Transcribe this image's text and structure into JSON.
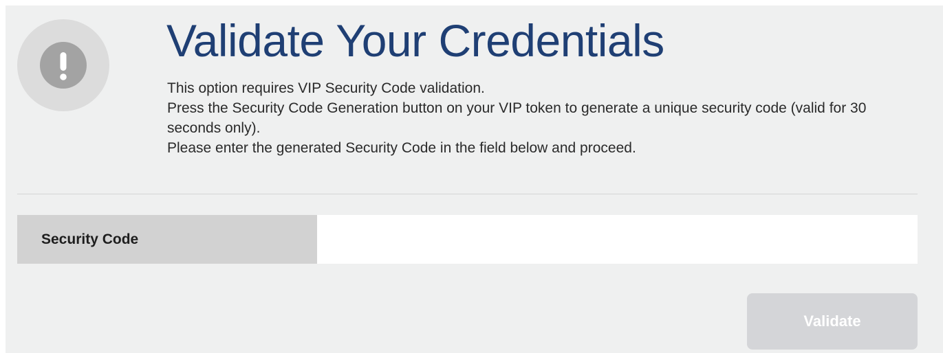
{
  "header": {
    "icon": "exclamation-icon",
    "title": "Validate Your Credentials"
  },
  "description": {
    "line1": "This option requires VIP Security Code validation.",
    "line2": "Press the Security Code Generation button on your VIP token to generate a unique security code (valid for 30 seconds only).",
    "line3": "Please enter the generated Security Code in the field below and proceed."
  },
  "form": {
    "security_code_label": "Security Code",
    "security_code_value": "",
    "security_code_placeholder": ""
  },
  "actions": {
    "validate_label": "Validate"
  },
  "colors": {
    "title": "#1f3f74",
    "panel_background": "#eff0f0",
    "label_background": "#d2d2d2",
    "button_background": "#d4d5d8"
  }
}
